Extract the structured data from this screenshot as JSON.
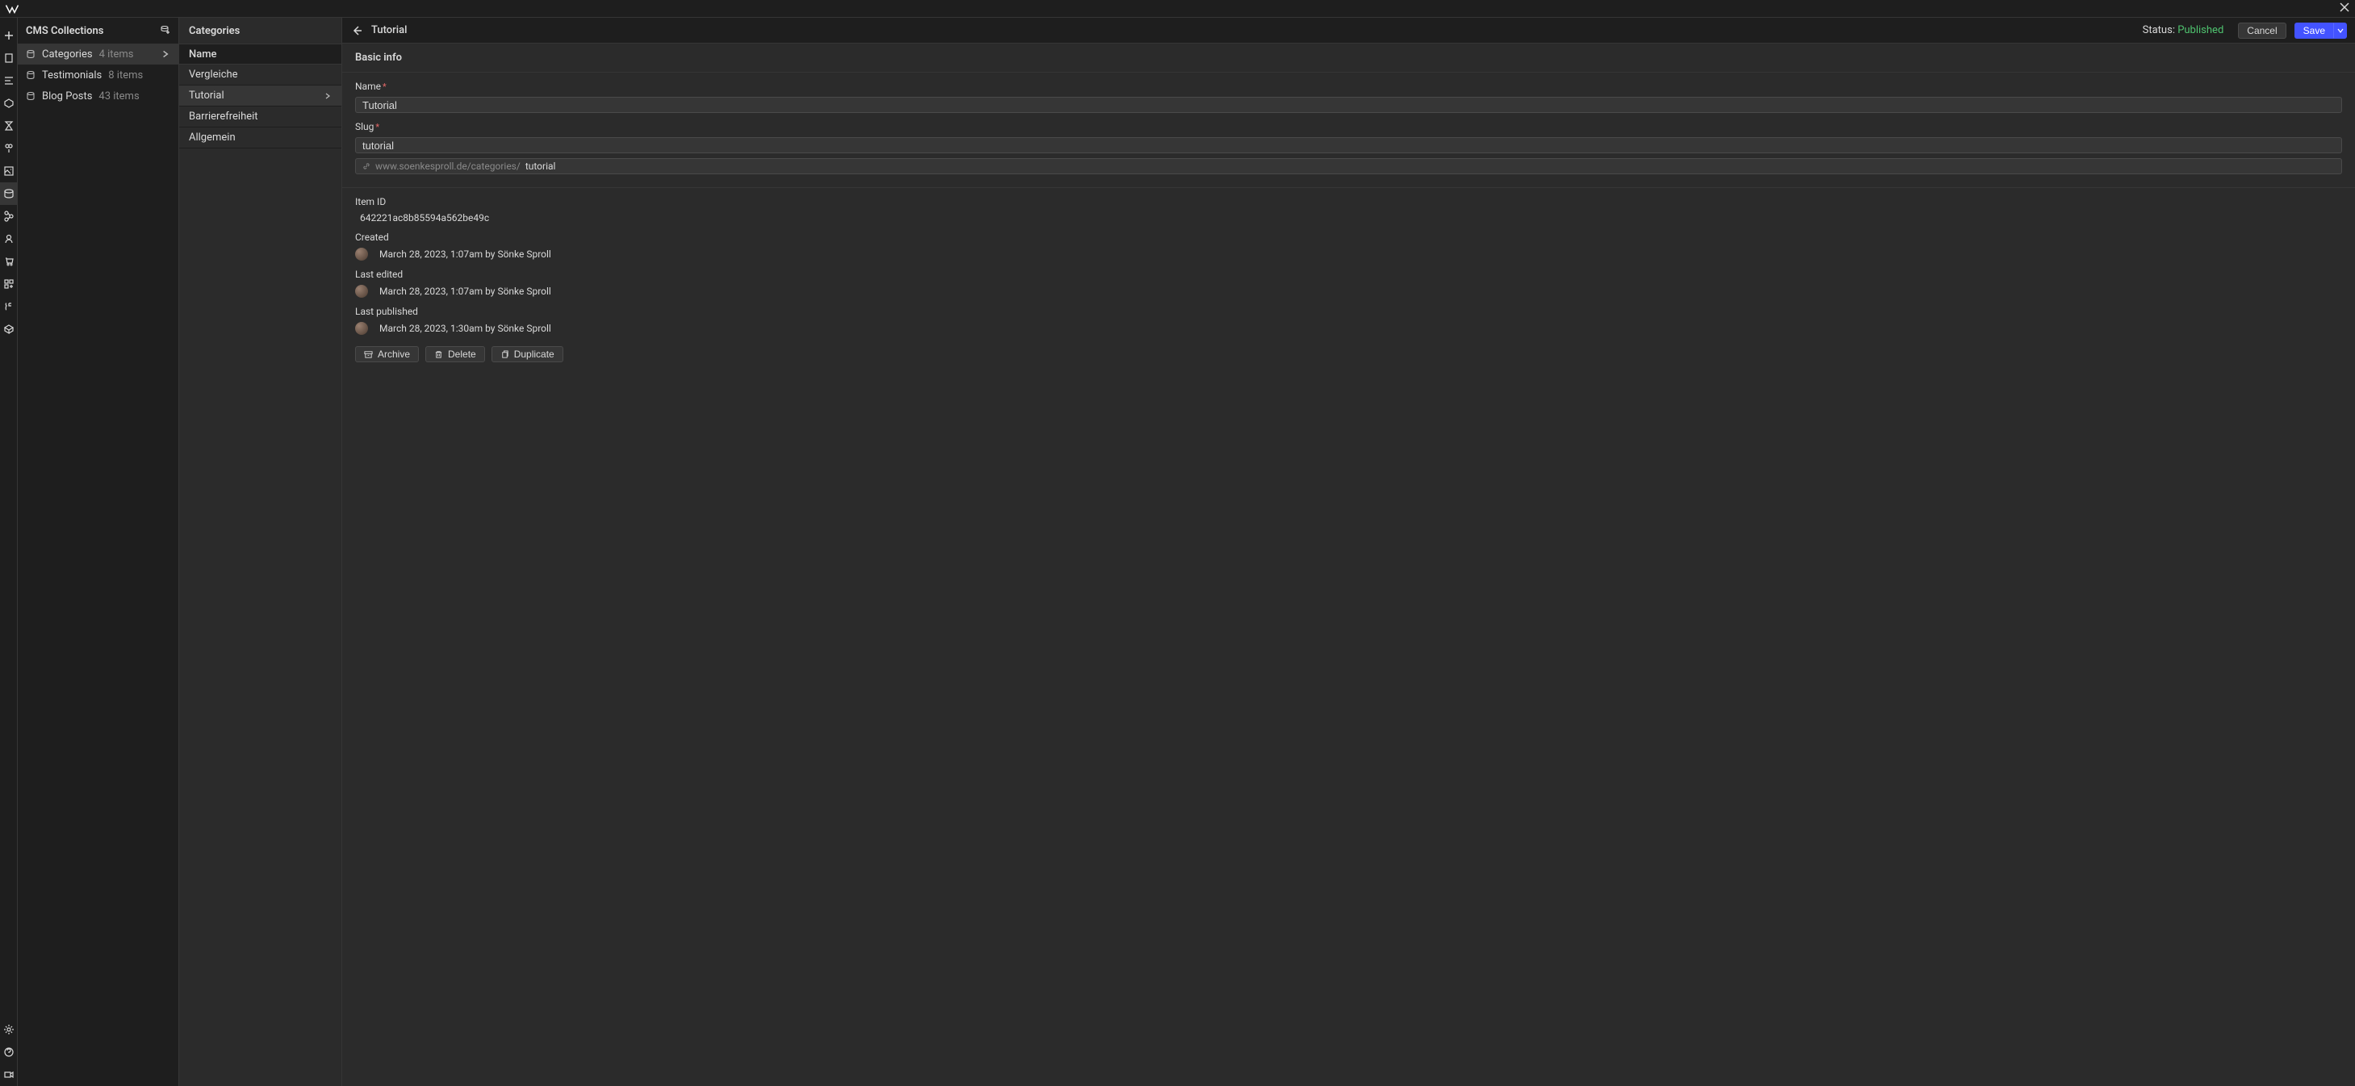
{
  "panel_title": "CMS Collections",
  "collections": [
    {
      "name": "Categories",
      "count": "4 items",
      "active": true
    },
    {
      "name": "Testimonials",
      "count": "8 items",
      "active": false
    },
    {
      "name": "Blog Posts",
      "count": "43 items",
      "active": false
    }
  ],
  "items_panel": {
    "title": "Categories",
    "col_head": "Name",
    "items": [
      {
        "name": "Vergleiche",
        "active": false
      },
      {
        "name": "Tutorial",
        "active": true
      },
      {
        "name": "Barrierefreiheit",
        "active": false
      },
      {
        "name": "Allgemein",
        "active": false
      }
    ]
  },
  "detail": {
    "title": "Tutorial",
    "status_label": "Status: ",
    "status_value": "Published",
    "cancel": "Cancel",
    "save": "Save",
    "section": "Basic info",
    "name_label": "Name",
    "name_value": "Tutorial",
    "slug_label": "Slug",
    "slug_value": "tutorial",
    "url_prefix": "www.soenkesproll.de/categories/",
    "url_slug": "tutorial",
    "item_id_label": "Item ID",
    "item_id": "642221ac8b85594a562be49c",
    "created_label": "Created",
    "created_value": "March 28, 2023, 1:07am by Sönke Sproll",
    "edited_label": "Last edited",
    "edited_value": "March 28, 2023, 1:07am by Sönke Sproll",
    "published_label": "Last published",
    "published_value": "March 28, 2023, 1:30am by Sönke Sproll",
    "archive": "Archive",
    "delete": "Delete",
    "duplicate": "Duplicate"
  }
}
